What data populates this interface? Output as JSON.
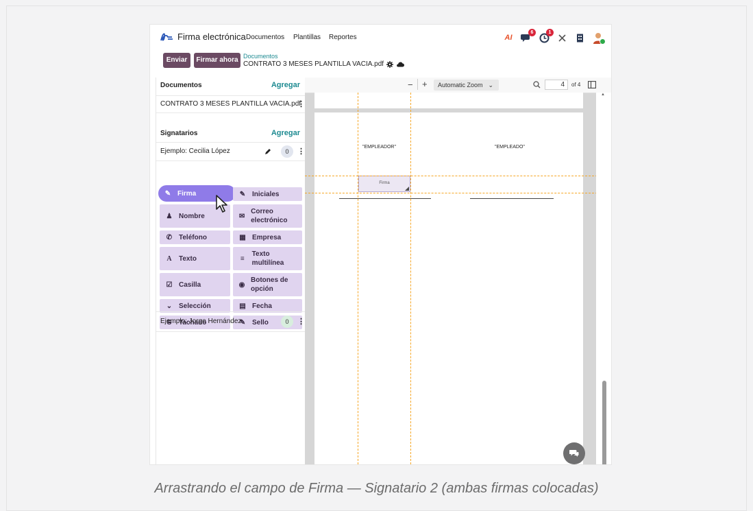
{
  "app": {
    "name": "Firma electrónica",
    "menus": [
      "Documentos",
      "Plantillas",
      "Reportes"
    ],
    "tray": {
      "ai_label": "AI",
      "messages_count": "6",
      "activity_count": "1"
    }
  },
  "control": {
    "send_label": "Enviar",
    "sign_now_label": "Firmar ahora",
    "breadcrumb_parent": "Documentos",
    "breadcrumb_current": "CONTRATO 3 MESES PLANTILLA VACIA.pdf"
  },
  "left": {
    "documents_title": "Documentos",
    "documents_add": "Agregar",
    "document_name": "CONTRATO 3 MESES PLANTILLA VACIA.pdf",
    "signers_title": "Signatarios",
    "signers_add": "Agregar",
    "signer1": {
      "name": "Ejemplo: Cecilia López",
      "count": "0"
    },
    "signer2": {
      "name": "Ejemplo: Jorge Hernández",
      "count": "0"
    },
    "fields": [
      {
        "label": "Firma",
        "icon": "pen-square-icon"
      },
      {
        "label": "Iniciales",
        "icon": "pen-square-icon"
      },
      {
        "label": "Nombre",
        "icon": "user-icon"
      },
      {
        "label": "Correo electrónico",
        "icon": "envelope-icon"
      },
      {
        "label": "Teléfono",
        "icon": "phone-icon"
      },
      {
        "label": "Empresa",
        "icon": "building-icon"
      },
      {
        "label": "Texto",
        "icon": "font-icon"
      },
      {
        "label": "Texto multilínea",
        "icon": "align-justify-icon"
      },
      {
        "label": "Casilla",
        "icon": "checkbox-icon"
      },
      {
        "label": "Botones de opción",
        "icon": "radio-icon"
      },
      {
        "label": "Selección",
        "icon": "chevron-down-icon"
      },
      {
        "label": "Fecha",
        "icon": "calendar-icon"
      },
      {
        "label": "Tachado",
        "icon": "strikethrough-icon"
      },
      {
        "label": "Sello",
        "icon": "pen-square-icon"
      }
    ]
  },
  "viewer": {
    "zoom": "Automatic Zoom",
    "page": "4",
    "of_pages": "of 4",
    "page_text_left": "\"EMPLEADOR\"",
    "page_text_right": "\"EMPLEADO\"",
    "placed_field": "Firma"
  },
  "caption": "Arrastrando el campo de Firma — Signatario 2 (ambas firmas colocadas)",
  "colors": {
    "accent": "#6b4a63",
    "link": "#1d8a91",
    "field_bg": "#e0d4ef",
    "drag_field": "#8f7be8",
    "guide": "#f6a623"
  }
}
